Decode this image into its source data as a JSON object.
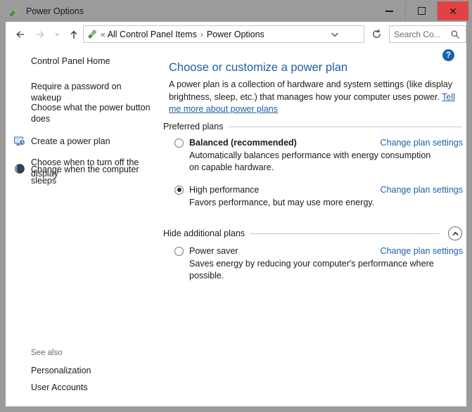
{
  "window": {
    "title": "Power Options",
    "app_icon": "power-plug-icon",
    "controls": {
      "minimize_label": "—",
      "maximize_label": "□",
      "close_label": "✕"
    },
    "close_color": "#e04343",
    "titlebar_color": "#9b9b9b"
  },
  "navbar": {
    "back_label": "Back",
    "forward_label": "Forward",
    "recent_label": "Recent locations",
    "up_label": "Up",
    "breadcrumb": {
      "icon": "power-plug-icon",
      "double_chevron": "«",
      "separator": "›",
      "items": [
        "All Control Panel Items",
        "Power Options"
      ]
    },
    "dropdown_label": "ˇ",
    "refresh_label": "Refresh",
    "search": {
      "placeholder": "Search Co...",
      "value": "",
      "icon": "search-icon"
    }
  },
  "sidebar": {
    "items": [
      {
        "label": "Control Panel Home",
        "icon": null
      },
      {
        "label": "Require a password on wakeup",
        "icon": null
      },
      {
        "label": "Choose what the power button does",
        "icon": null
      },
      {
        "label": "Create a power plan",
        "icon": null
      },
      {
        "label": "Choose when to turn off the display",
        "icon": "display-clock-icon"
      },
      {
        "label": "Change when the computer sleeps",
        "icon": "sleep-moon-icon"
      }
    ],
    "see_also": {
      "label": "See also",
      "links": [
        "Personalization",
        "User Accounts"
      ]
    }
  },
  "main": {
    "help_label": "?",
    "heading": "Choose or customize a power plan",
    "description_part1": "A power plan is a collection of hardware and system settings (like display brightness, sleep, etc.) that manages how your computer uses power. ",
    "description_link": "Tell me more about power plans",
    "preferred_section_label": "Preferred plans",
    "additional_section_label": "Hide additional plans",
    "collapse_icon": "chevron-up-icon",
    "change_link_label": "Change plan settings",
    "plans": [
      {
        "name": "Balanced (recommended)",
        "bold": true,
        "selected": false,
        "description": "Automatically balances performance with energy consumption on capable hardware.",
        "link": "Change plan settings"
      },
      {
        "name": "High performance",
        "bold": false,
        "selected": true,
        "description": "Favors performance, but may use more energy.",
        "link": "Change plan settings"
      },
      {
        "name": "Power saver",
        "bold": false,
        "selected": false,
        "description": "Saves energy by reducing your computer's performance where possible.",
        "link": "Change plan settings"
      }
    ],
    "accent_link_color": "#1f5fa8",
    "heading_color": "#1f5fa8"
  }
}
